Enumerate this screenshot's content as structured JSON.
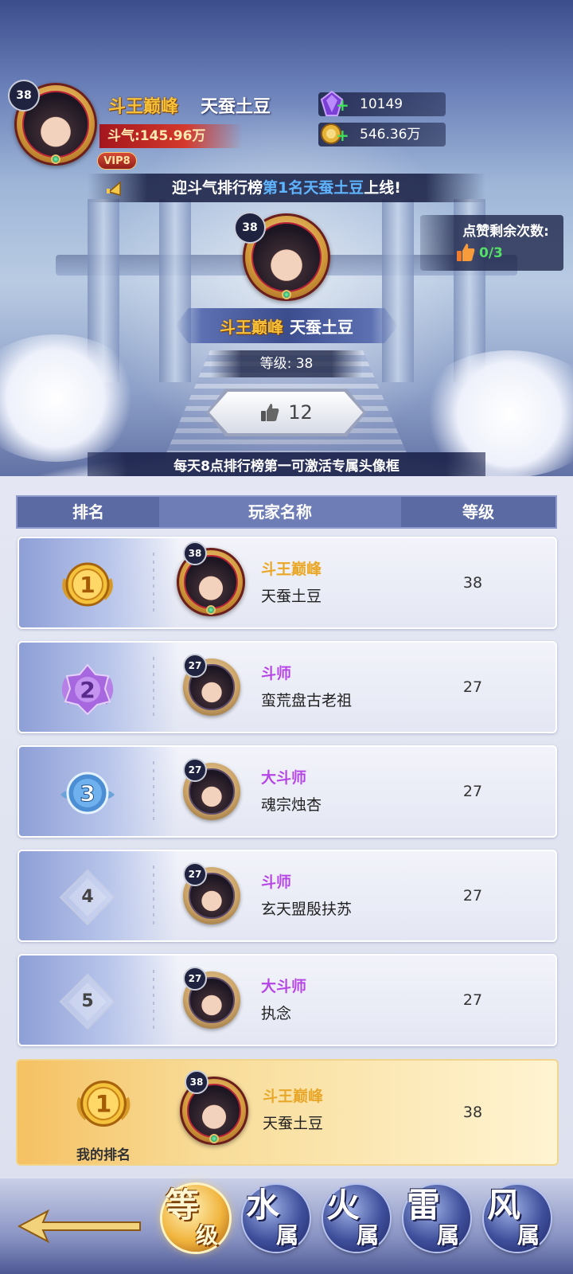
{
  "profile": {
    "level": "38",
    "title": "斗王巅峰",
    "name": "天蚕土豆",
    "power": "斗气:145.96万",
    "vip": "VIP8"
  },
  "currency": {
    "gems": "10149",
    "gold": "546.36万"
  },
  "announcement": {
    "prefix": "迎斗气排行榜",
    "highlight": "第1名天蚕土豆",
    "suffix": "上线!"
  },
  "likes_remaining": {
    "label": "点赞剩余次数:",
    "value": "0/3"
  },
  "top_player": {
    "level": "38",
    "title": "斗王巅峰",
    "name": "天蚕土豆",
    "level_text": "等级: 38",
    "like_count": "12"
  },
  "tip": "每天8点排行榜第一可激活专属头像框",
  "table": {
    "headers": [
      "排名",
      "玩家名称",
      "等级"
    ],
    "rows": [
      {
        "rank": "1",
        "avatar_level": "38",
        "title": "斗王巅峰",
        "name": "天蚕土豆",
        "level": "38",
        "title_color": "gold"
      },
      {
        "rank": "2",
        "avatar_level": "27",
        "title": "斗师",
        "name": "蛮荒盘古老祖",
        "level": "27",
        "title_color": "purple"
      },
      {
        "rank": "3",
        "avatar_level": "27",
        "title": "大斗师",
        "name": "魂宗烛杏",
        "level": "27",
        "title_color": "purple"
      },
      {
        "rank": "4",
        "avatar_level": "27",
        "title": "斗师",
        "name": "玄天盟殷扶苏",
        "level": "27",
        "title_color": "purple"
      },
      {
        "rank": "5",
        "avatar_level": "27",
        "title": "大斗师",
        "name": "执念",
        "level": "27",
        "title_color": "purple"
      }
    ]
  },
  "my_rank": {
    "rank": "1",
    "label": "我的排名",
    "avatar_level": "38",
    "title": "斗王巅峰",
    "name": "天蚕土豆",
    "level": "38"
  },
  "tabs": [
    {
      "big": "等",
      "small": "级",
      "active": true
    },
    {
      "big": "水",
      "small": "属",
      "active": false
    },
    {
      "big": "火",
      "small": "属",
      "active": false
    },
    {
      "big": "雷",
      "small": "属",
      "active": false
    },
    {
      "big": "风",
      "small": "属",
      "active": false
    }
  ],
  "colors": {
    "gold_title": "#f7c23a",
    "purple_title": "#b546e6",
    "header_bg": "#5b6aa3",
    "likes_green": "#53e069"
  },
  "icons": [
    "gem-icon",
    "gold-coin-icon",
    "plus-icon",
    "bell-icon",
    "thumbs-up-icon",
    "medal-gold-icon",
    "medal-purple-icon",
    "medal-blue-icon",
    "back-arrow-icon"
  ]
}
